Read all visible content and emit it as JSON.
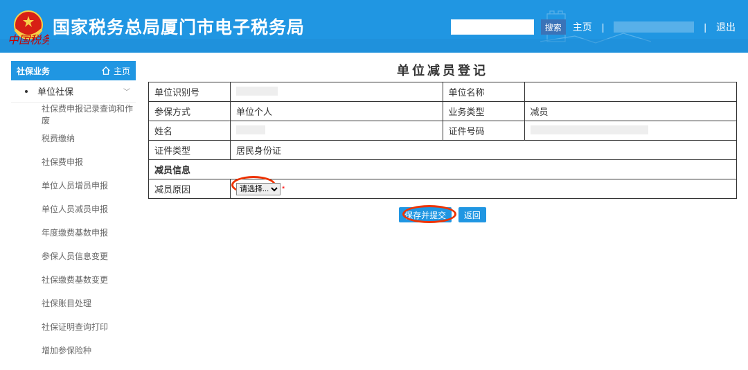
{
  "header": {
    "app_title": "国家税务总局厦门市电子税务局",
    "search_placeholder": "",
    "search_btn": "搜索",
    "home": "主页",
    "logout": "退出"
  },
  "sidebar": {
    "category": "社保业务",
    "home": "主页",
    "first_item": "单位社保",
    "menu": [
      "社保费申报记录查询和作废",
      "税费缴纳",
      "社保费申报",
      "单位人员增员申报",
      "单位人员减员申报",
      "年度缴费基数申报",
      "参保人员信息变更",
      "社保缴费基数变更",
      "社保账目处理",
      "社保证明查询打印",
      "增加参保险种"
    ]
  },
  "main": {
    "title": "单位减员登记",
    "fields": {
      "unit_id": "单位识别号",
      "unit_name": "单位名称",
      "insure_mode": "参保方式",
      "insure_mode_val": "单位个人",
      "biz_type": "业务类型",
      "biz_type_val": "减员",
      "name": "姓名",
      "cert_no": "证件号码",
      "cert_type": "证件类型",
      "cert_type_val": "居民身份证",
      "section": "减员信息",
      "reason": "减员原因",
      "reason_placeholder": "请选择..."
    },
    "buttons": {
      "save": "保存并提交",
      "back": "返回"
    }
  }
}
